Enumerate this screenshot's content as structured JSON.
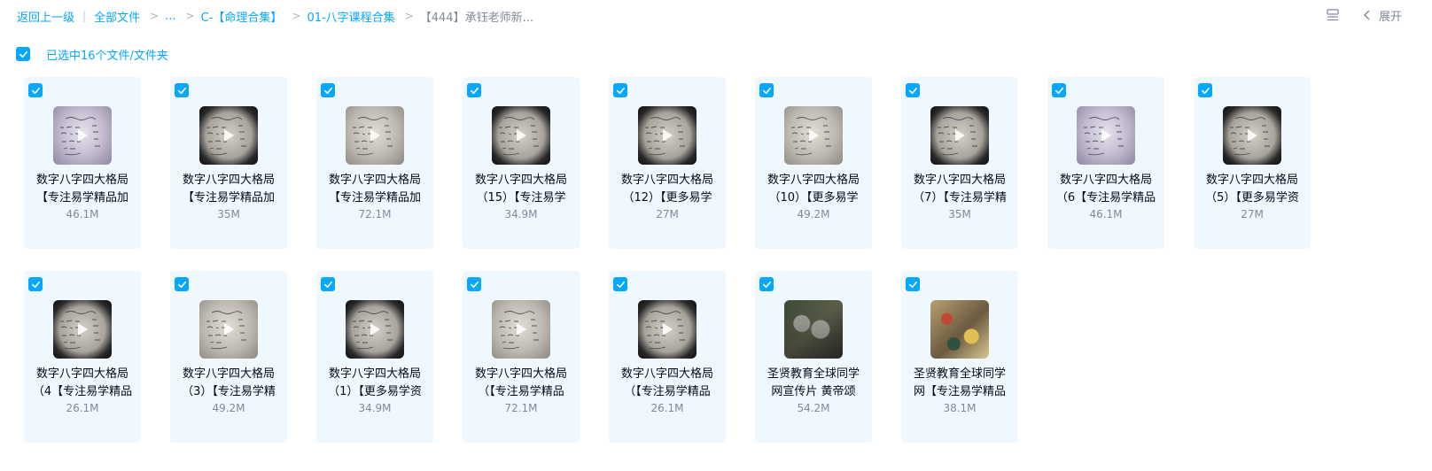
{
  "breadcrumb": {
    "back": "返回上一级",
    "all_files": "全部文件",
    "ellipsis": "...",
    "folder1": "C-【命理合集】",
    "folder2": "01-八字课程合集",
    "current": "【444】承钰老师新...",
    "separator": "|",
    "arrow": ">"
  },
  "toolbar": {
    "list_view_icon": "list-view-icon",
    "expand_label": "展开"
  },
  "selection": {
    "label": "已选中16个文件/文件夹"
  },
  "colors": {
    "accent": "#06a7ff",
    "card_bg": "#f0f8ff",
    "text": "#03081a",
    "muted": "#818999"
  },
  "files": [
    {
      "line1": "数字八字四大格局",
      "line2": "【专注易学精品加",
      "size": "46.1M",
      "thumb": "t-purple"
    },
    {
      "line1": "数字八字四大格局",
      "line2": "【专注易学精品加",
      "size": "35M",
      "thumb": "t-dark"
    },
    {
      "line1": "数字八字四大格局",
      "line2": "【专注易学精品加",
      "size": "72.1M",
      "thumb": "t-gray"
    },
    {
      "line1": "数字八字四大格局",
      "line2": "（15）【专注易学",
      "size": "34.9M",
      "thumb": "t-dark"
    },
    {
      "line1": "数字八字四大格局",
      "line2": "（12）【更多易学",
      "size": "27M",
      "thumb": "t-dark"
    },
    {
      "line1": "数字八字四大格局",
      "line2": "（10）【更多易学",
      "size": "49.2M",
      "thumb": "t-gray"
    },
    {
      "line1": "数字八字四大格局",
      "line2": "（7）【专注易学精",
      "size": "35M",
      "thumb": "t-dark"
    },
    {
      "line1": "数字八字四大格局",
      "line2": "（6【专注易学精品",
      "size": "46.1M",
      "thumb": "t-purple"
    },
    {
      "line1": "数字八字四大格局",
      "line2": "（5）【更多易学资",
      "size": "27M",
      "thumb": "t-dark"
    },
    {
      "line1": "数字八字四大格局",
      "line2": "（4【专注易学精品",
      "size": "26.1M",
      "thumb": "t-dark"
    },
    {
      "line1": "数字八字四大格局",
      "line2": "（3）【专注易学精",
      "size": "49.2M",
      "thumb": "t-gray"
    },
    {
      "line1": "数字八字四大格局",
      "line2": "（1）【更多易学资",
      "size": "34.9M",
      "thumb": "t-dark"
    },
    {
      "line1": "数字八字四大格局",
      "line2": "（【专注易学精品",
      "size": "72.1M",
      "thumb": "t-gray"
    },
    {
      "line1": "数字八字四大格局",
      "line2": "（【专注易学精品",
      "size": "26.1M",
      "thumb": "t-dark"
    },
    {
      "line1": "圣贤教育全球同学",
      "line2": "网宣传片 黄帝颂",
      "size": "54.2M",
      "thumb": "t-photo1"
    },
    {
      "line1": "圣贤教育全球同学",
      "line2": "网【专注易学精品",
      "size": "38.1M",
      "thumb": "t-photo2"
    }
  ]
}
